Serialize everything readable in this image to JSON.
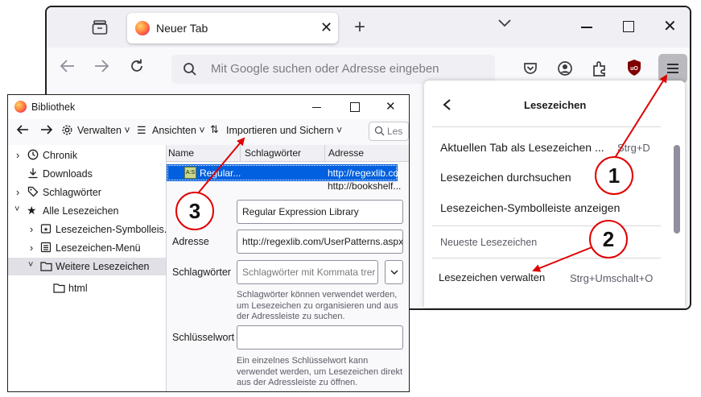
{
  "browser": {
    "tab": {
      "title": "Neuer Tab"
    },
    "urlbar": {
      "placeholder": "Mit Google suchen oder Adresse eingeben"
    }
  },
  "bookmarks_panel": {
    "title": "Lesezeichen",
    "items": [
      {
        "label": "Aktuellen Tab als Lesezeichen ...",
        "shortcut": "Strg+D"
      },
      {
        "label": "Lesezeichen durchsuchen",
        "shortcut": ""
      },
      {
        "label": "Lesezeichen-Symbolleiste anzeigen",
        "shortcut": ""
      }
    ],
    "recent_header": "Neueste Lesezeichen",
    "manage": {
      "label": "Lesezeichen verwalten",
      "shortcut": "Strg+Umschalt+O"
    }
  },
  "library": {
    "title": "Bibliothek",
    "toolbar": {
      "organize": "Verwalten",
      "views": "Ansichten",
      "import": "Importieren und Sichern",
      "search_placeholder": "Les"
    },
    "tree": [
      {
        "label": "Chronik"
      },
      {
        "label": "Downloads"
      },
      {
        "label": "Schlagwörter"
      },
      {
        "label": "Alle Lesezeichen"
      },
      {
        "label": "Lesezeichen-Symbolleis..."
      },
      {
        "label": "Lesezeichen-Menü"
      },
      {
        "label": "Weitere Lesezeichen"
      },
      {
        "label": "html"
      }
    ],
    "columns": [
      "Name",
      "Schlagwörter",
      "Adresse"
    ],
    "rows": [
      {
        "name": "Regular...",
        "address": "http://regexlib.co"
      },
      {
        "name": "",
        "address": "http://bookshelf..."
      }
    ],
    "details": {
      "name_value": "Regular Expression Library",
      "address_label": "Adresse",
      "address_value": "http://regexlib.com/UserPatterns.aspx",
      "tags_label": "Schlagwörter",
      "tags_placeholder": "Schlagwörter mit Kommata trer",
      "tags_help": "Schlagwörter können verwendet werden, um Lesezeichen zu organisieren und aus der Adressleiste zu suchen.",
      "keyword_label": "Schlüsselwort",
      "keyword_value": "",
      "keyword_help": "Ein einzelnes Schlüsselwort kann verwendet werden, um Lesezeichen direkt aus der Adressleiste zu öffnen."
    }
  },
  "callouts": [
    "1",
    "2",
    "3"
  ],
  "colors": {
    "arrow": "#e00000",
    "selection": "#0060df"
  }
}
